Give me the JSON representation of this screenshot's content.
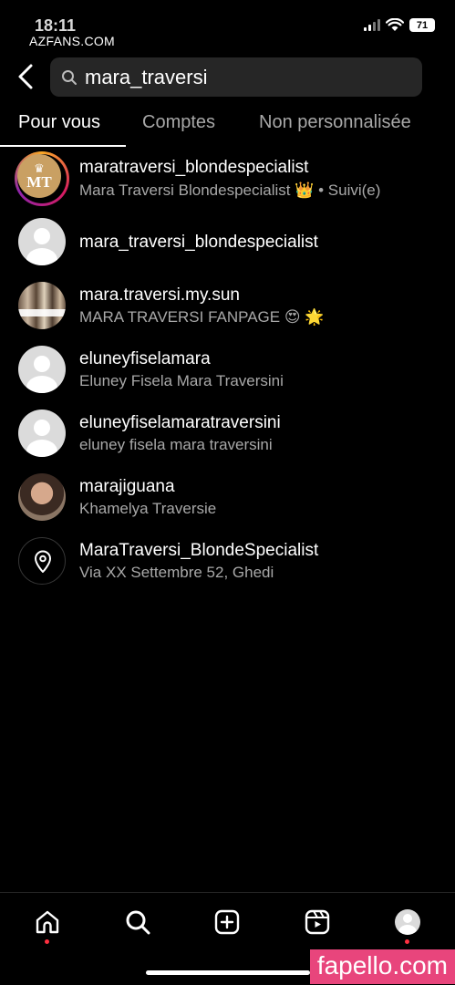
{
  "status_bar": {
    "time": "18:11",
    "battery": "71",
    "watermark": "AZFANS.COM"
  },
  "search": {
    "query": "mara_traversi"
  },
  "tabs": [
    {
      "label": "Pour vous",
      "active": true
    },
    {
      "label": "Comptes",
      "active": false
    },
    {
      "label": "Non personnalisée",
      "active": false
    }
  ],
  "results": [
    {
      "username": "maratraversi_blondespecialist",
      "subtitle": "Mara Traversi Blondespecialist 👑 • Suivi(e)",
      "avatar": "mt-logo",
      "logo_text": "MT"
    },
    {
      "username": "mara_traversi_blondespecialist",
      "subtitle": "",
      "avatar": "default"
    },
    {
      "username": "mara.traversi.my.sun",
      "subtitle": "MARA TRAVERSI FANPAGE 😍 🌟",
      "avatar": "hair-photo"
    },
    {
      "username": "eluneyfiselamara",
      "subtitle": "Eluney Fisela Mara Traversini",
      "avatar": "default"
    },
    {
      "username": "eluneyfiselamaratraversini",
      "subtitle": "eluney fisela mara traversini",
      "avatar": "default"
    },
    {
      "username": "marajiguana",
      "subtitle": "Khamelya Traversie",
      "avatar": "face-photo"
    },
    {
      "username": "MaraTraversi_BlondeSpecialist",
      "subtitle": "Via XX Settembre 52, Ghedi",
      "avatar": "location-pin-icon"
    }
  ],
  "bottom_nav": [
    {
      "name": "home-icon",
      "notification": true
    },
    {
      "name": "search-icon",
      "notification": false
    },
    {
      "name": "create-post-icon",
      "notification": false
    },
    {
      "name": "reels-icon",
      "notification": false
    },
    {
      "name": "profile-avatar",
      "notification": true
    }
  ],
  "watermark_bottom": "fapello.com",
  "colors": {
    "background": "#000000",
    "search_box": "#262626",
    "secondary_text": "#a8a8a8",
    "notification_dot": "#ff3040",
    "watermark_bg": "#e8457c"
  }
}
